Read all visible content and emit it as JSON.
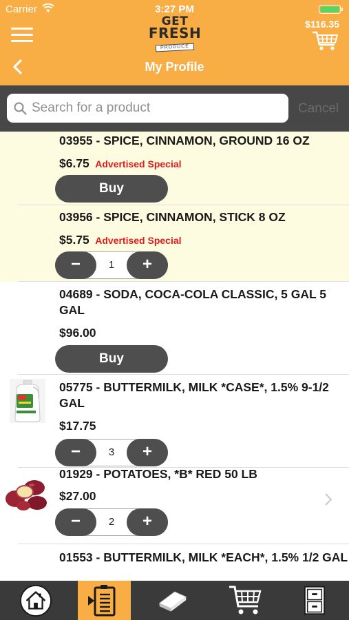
{
  "status_bar": {
    "carrier": "Carrier",
    "time": "3:27 PM"
  },
  "header": {
    "logo": {
      "line1": "GET",
      "line2": "FRESH",
      "line3": "PRODUCE"
    },
    "cart_total": "$116.35",
    "title": "My Profile"
  },
  "search": {
    "placeholder": "Search for a product",
    "cancel_label": "Cancel"
  },
  "colors": {
    "brand_orange": "#f8ad45",
    "special_red": "#e41b1b",
    "button_gray": "#4e4e4e",
    "special_bg": "#fdfbe0"
  },
  "products": [
    {
      "title": "03955 - SPICE, CINNAMON, GROUND 16 OZ",
      "price": "$6.75",
      "special": "Advertised Special",
      "action": "Buy",
      "highlighted": true
    },
    {
      "title": "03956 - SPICE, CINNAMON, STICK 8 OZ",
      "price": "$5.75",
      "special": "Advertised Special",
      "quantity": "1",
      "minus": "−",
      "plus": "+",
      "highlighted": true
    },
    {
      "title": "04689 - SODA, COCA-COLA CLASSIC, 5 GAL 5 GAL",
      "price": "$96.00",
      "action": "Buy"
    },
    {
      "title": "05775 - BUTTERMILK, MILK *CASE*, 1.5% 9-1/2 GAL",
      "price": "$17.75",
      "quantity": "3",
      "minus": "−",
      "plus": "+",
      "image": "buttermilk-jug"
    },
    {
      "title": "01929 - POTATOES, *B* RED 50 LB",
      "price": "$27.00",
      "quantity": "2",
      "minus": "−",
      "plus": "+",
      "image": "red-potatoes"
    },
    {
      "title": "01553 - BUTTERMILK, MILK *EACH*, 1.5% 1/2 GAL"
    }
  ],
  "tabbar": {
    "tabs": [
      {
        "icon": "home-icon"
      },
      {
        "icon": "order-list-icon",
        "active": true
      },
      {
        "icon": "catalog-book-icon"
      },
      {
        "icon": "shopping-cart-icon"
      },
      {
        "icon": "filing-cabinet-icon"
      }
    ]
  }
}
